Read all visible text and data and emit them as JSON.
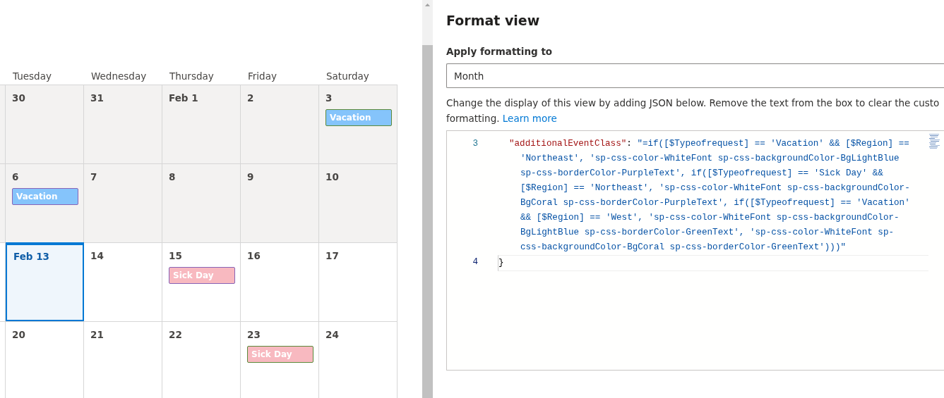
{
  "calendar": {
    "weekdays": [
      "Tuesday",
      "Wednesday",
      "Thursday",
      "Friday",
      "Saturday"
    ],
    "weeks": [
      {
        "days": [
          {
            "label": "30",
            "past": true,
            "selected": false
          },
          {
            "label": "31",
            "past": true,
            "selected": false
          },
          {
            "label": "Feb 1",
            "past": true,
            "selected": false
          },
          {
            "label": "2",
            "past": true,
            "selected": false
          },
          {
            "label": "3",
            "past": true,
            "selected": false,
            "events": [
              {
                "label": "Vacation",
                "kind": "vacation",
                "color": "#5b8a3a"
              }
            ]
          }
        ]
      },
      {
        "days": [
          {
            "label": "6",
            "past": true,
            "selected": false,
            "events": [
              {
                "label": "Vacation",
                "kind": "vacation",
                "color": "#8764b8"
              }
            ]
          },
          {
            "label": "7",
            "past": true,
            "selected": false
          },
          {
            "label": "8",
            "past": true,
            "selected": false
          },
          {
            "label": "9",
            "past": true,
            "selected": false
          },
          {
            "label": "10",
            "past": true,
            "selected": false
          }
        ]
      },
      {
        "days": [
          {
            "label": "Feb 13",
            "past": false,
            "selected": true
          },
          {
            "label": "14",
            "past": false,
            "selected": false
          },
          {
            "label": "15",
            "past": false,
            "selected": false,
            "events": [
              {
                "label": "Sick Day",
                "kind": "sick",
                "color": "#8764b8"
              }
            ]
          },
          {
            "label": "16",
            "past": false,
            "selected": false
          },
          {
            "label": "17",
            "past": false,
            "selected": false
          }
        ]
      },
      {
        "days": [
          {
            "label": "20",
            "past": false,
            "selected": false
          },
          {
            "label": "21",
            "past": false,
            "selected": false
          },
          {
            "label": "22",
            "past": false,
            "selected": false
          },
          {
            "label": "23",
            "past": false,
            "selected": false,
            "events": [
              {
                "label": "Sick Day",
                "kind": "sick",
                "color": "#5b8a3a"
              }
            ]
          },
          {
            "label": "24",
            "past": false,
            "selected": false
          }
        ]
      }
    ]
  },
  "panel": {
    "title": "Format view",
    "apply_label": "Apply formatting to",
    "apply_value": "Month",
    "description_lines": [
      "Change the display of this view by adding JSON below. Remove the text from the box to clear the custo",
      "formatting."
    ],
    "link": "Learn more",
    "editor": {
      "lines": [
        {
          "number": "3",
          "active": false,
          "key": "\"additionalEventClass\"",
          "separator": ": ",
          "value": "\"=if([$Typeofrequest] == 'Vacation' && [$Region] == 'Northeast', 'sp-css-color-WhiteFont sp-css-backgroundColor-BgLightBlue sp-css-borderColor-PurpleText', if([$Typeofrequest] == 'Sick Day' && [$Region] == 'Northeast', 'sp-css-color-WhiteFont sp-css-backgroundColor-BgCoral sp-css-borderColor-PurpleText', if([$Typeofrequest] == 'Vacation' && [$Region] == 'West', 'sp-css-color-WhiteFont sp-css-backgroundColor-BgLightBlue sp-css-borderColor-GreenText', 'sp-css-color-WhiteFont sp-css-backgroundColor-BgCoral sp-css-borderColor-GreenText')))\""
        },
        {
          "number": "4",
          "active": true,
          "text": "}"
        }
      ]
    }
  }
}
